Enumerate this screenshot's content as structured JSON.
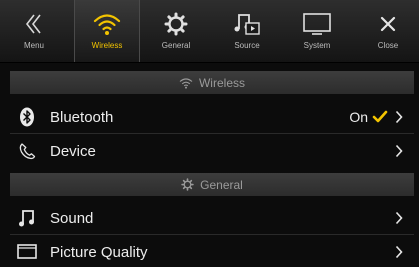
{
  "tabs": [
    {
      "id": "menu",
      "label": "Menu"
    },
    {
      "id": "wireless",
      "label": "Wireless"
    },
    {
      "id": "general",
      "label": "General"
    },
    {
      "id": "source",
      "label": "Source"
    },
    {
      "id": "system",
      "label": "System"
    },
    {
      "id": "close",
      "label": "Close"
    }
  ],
  "active_tab": "wireless",
  "accent_color": "#f3c400",
  "sections": {
    "wireless": {
      "title": "Wireless",
      "icon": "wifi-icon"
    },
    "general": {
      "title": "General",
      "icon": "gear-icon"
    }
  },
  "rows": {
    "bluetooth": {
      "label": "Bluetooth",
      "value": "On",
      "icon": "bluetooth-icon",
      "checked": true
    },
    "device": {
      "label": "Device",
      "icon": "phone-handset-icon"
    },
    "sound": {
      "label": "Sound",
      "icon": "music-note-icon"
    },
    "picture_quality": {
      "label": "Picture Quality",
      "icon": "picture-icon"
    }
  }
}
